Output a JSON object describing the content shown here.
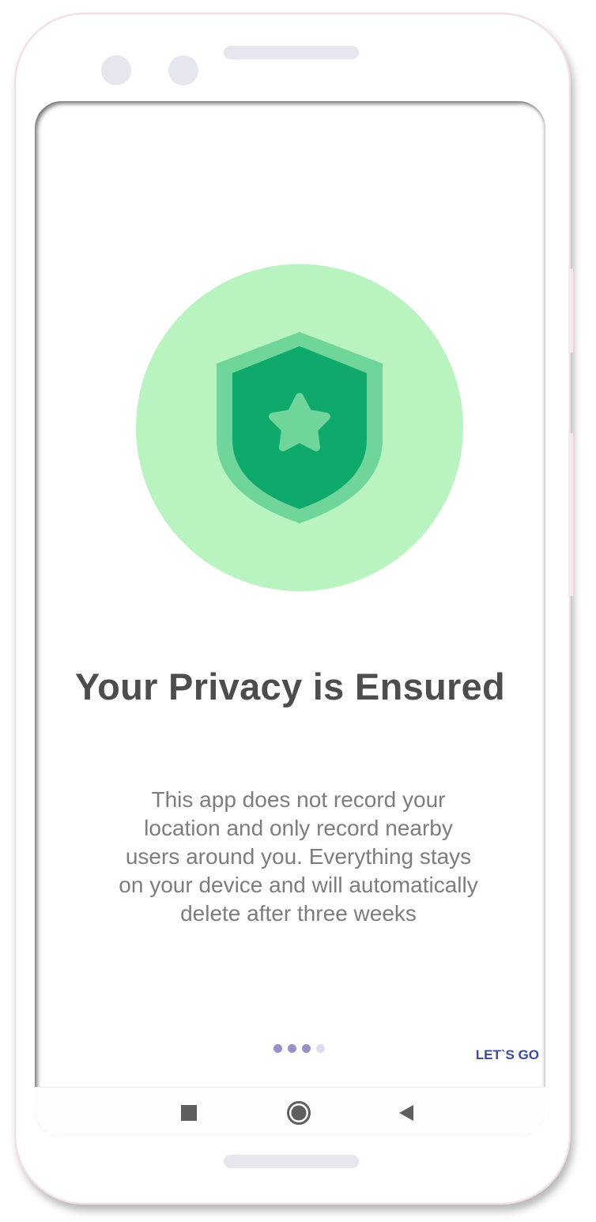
{
  "screen": {
    "title": "Your Privacy is Ensured",
    "description": "This app does not record your\nlocation and only record nearby\nusers around you. Everything stays\non your device and will automatically\ndelete after three weeks",
    "illustration": {
      "icon": "shield-star-icon",
      "circle_color": "#b9f4c0",
      "shield_outer_color": "#6fd59a",
      "shield_inner_color": "#10a96c",
      "star_color": "#6fd59a"
    }
  },
  "pager": {
    "total_pages": 4,
    "current_page": 3,
    "active_color": "#9c8fc7",
    "inactive_color": "#e0dcef"
  },
  "actions": {
    "lets_go_label": "LET`S GO"
  },
  "nav_bar": {
    "recents_icon": "square-icon",
    "home_icon": "circle-home-icon",
    "back_icon": "triangle-back-icon"
  }
}
